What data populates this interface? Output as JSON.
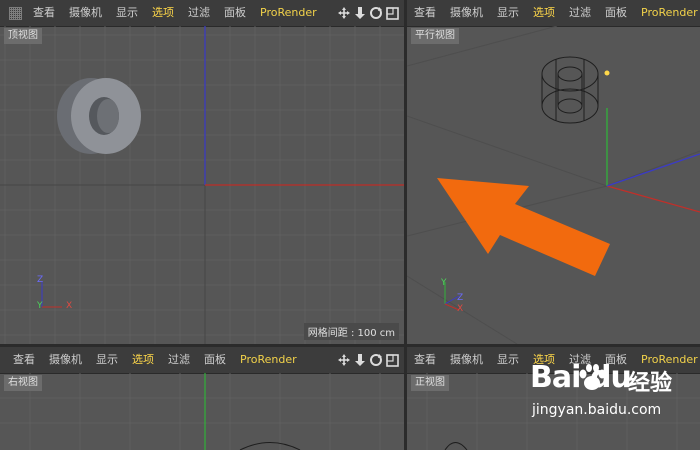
{
  "menu": {
    "view": "查看",
    "camera": "摄像机",
    "display": "显示",
    "options": "选项",
    "filter": "过滤",
    "panel": "面板",
    "prorender": "ProRender"
  },
  "viewports": {
    "top": {
      "label": "顶视图",
      "grid_spacing": "网格间距 : 100 cm"
    },
    "perspective": {
      "label": "平行视图"
    },
    "right": {
      "label": "右视图"
    },
    "front": {
      "label": "正视图"
    }
  },
  "axes": {
    "x": "X",
    "y": "Y",
    "z": "Z"
  },
  "watermark": {
    "brand_left": "Bai",
    "brand_right": "du",
    "product": "经验",
    "domain": "jingyan.baidu.com"
  },
  "colors": {
    "accent_active": "#ffd84a",
    "arrow": "#f26a0e",
    "axis_x": "#c0302a",
    "axis_y": "#31b13a",
    "axis_z": "#3a3ac9"
  },
  "icons": [
    "grip-icon",
    "move-icon",
    "down-arrow-icon",
    "rotate-icon",
    "maximize-icon"
  ]
}
